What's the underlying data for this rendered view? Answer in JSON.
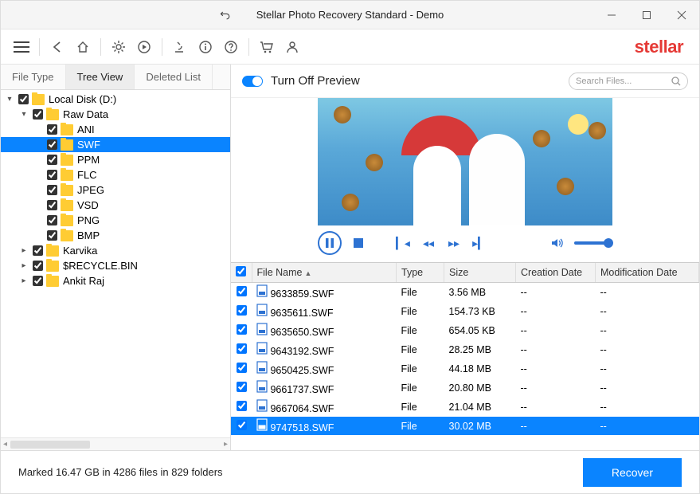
{
  "window": {
    "title": "Stellar Photo Recovery Standard - Demo"
  },
  "brand": "stellar",
  "tabs": {
    "file_type": "File Type",
    "tree_view": "Tree View",
    "deleted_list": "Deleted List",
    "active": "Tree View"
  },
  "tree": [
    {
      "indent": 0,
      "expander": "▾",
      "checked": true,
      "label": "Local Disk (D:)"
    },
    {
      "indent": 1,
      "expander": "▾",
      "checked": true,
      "label": "Raw Data"
    },
    {
      "indent": 2,
      "expander": "",
      "checked": true,
      "label": "ANI"
    },
    {
      "indent": 2,
      "expander": "",
      "checked": true,
      "label": "SWF",
      "selected": true
    },
    {
      "indent": 2,
      "expander": "",
      "checked": true,
      "label": "PPM"
    },
    {
      "indent": 2,
      "expander": "",
      "checked": true,
      "label": "FLC"
    },
    {
      "indent": 2,
      "expander": "",
      "checked": true,
      "label": "JPEG"
    },
    {
      "indent": 2,
      "expander": "",
      "checked": true,
      "label": "VSD"
    },
    {
      "indent": 2,
      "expander": "",
      "checked": true,
      "label": "PNG"
    },
    {
      "indent": 2,
      "expander": "",
      "checked": true,
      "label": "BMP"
    },
    {
      "indent": 1,
      "expander": "▸",
      "checked": true,
      "label": "Karvika"
    },
    {
      "indent": 1,
      "expander": "▸",
      "checked": true,
      "label": "$RECYCLE.BIN"
    },
    {
      "indent": 1,
      "expander": "▸",
      "checked": true,
      "label": "Ankit Raj"
    }
  ],
  "preview": {
    "toggle_label": "Turn Off Preview"
  },
  "search": {
    "placeholder": "Search Files..."
  },
  "columns": {
    "name": "File Name",
    "type": "Type",
    "size": "Size",
    "created": "Creation Date",
    "modified": "Modification Date"
  },
  "files": [
    {
      "checked": true,
      "name": "9633859.SWF",
      "type": "File",
      "size": "3.56 MB",
      "created": "--",
      "modified": "--"
    },
    {
      "checked": true,
      "name": "9635611.SWF",
      "type": "File",
      "size": "154.73 KB",
      "created": "--",
      "modified": "--"
    },
    {
      "checked": true,
      "name": "9635650.SWF",
      "type": "File",
      "size": "654.05 KB",
      "created": "--",
      "modified": "--"
    },
    {
      "checked": true,
      "name": "9643192.SWF",
      "type": "File",
      "size": "28.25 MB",
      "created": "--",
      "modified": "--"
    },
    {
      "checked": true,
      "name": "9650425.SWF",
      "type": "File",
      "size": "44.18 MB",
      "created": "--",
      "modified": "--"
    },
    {
      "checked": true,
      "name": "9661737.SWF",
      "type": "File",
      "size": "20.80 MB",
      "created": "--",
      "modified": "--"
    },
    {
      "checked": true,
      "name": "9667064.SWF",
      "type": "File",
      "size": "21.04 MB",
      "created": "--",
      "modified": "--"
    },
    {
      "checked": true,
      "name": "9747518.SWF",
      "type": "File",
      "size": "30.02 MB",
      "created": "--",
      "modified": "--",
      "selected": true
    }
  ],
  "status": "Marked 16.47 GB in 4286 files in 829 folders",
  "recover_label": "Recover"
}
